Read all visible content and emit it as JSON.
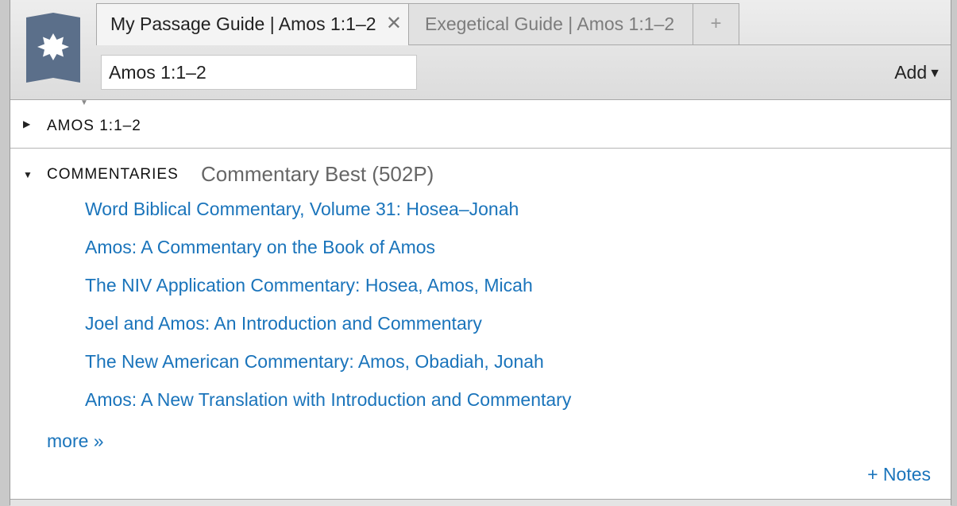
{
  "tabs": [
    {
      "label": "My Passage Guide | Amos 1:1–2",
      "active": true
    },
    {
      "label": "Exegetical Guide | Amos 1:1–2",
      "active": false
    }
  ],
  "tab_add_label": "+",
  "tab_close_label": "✕",
  "reference_input": {
    "value": "Amos 1:1–2"
  },
  "add_button": {
    "label": "Add",
    "arrow": "▼"
  },
  "sections": {
    "passage": {
      "title": "AMOS 1:1–2",
      "expanded": false,
      "toggle": "▶"
    },
    "commentaries": {
      "title": "COMMENTARIES",
      "subtitle": "Commentary Best (502P)",
      "expanded": true,
      "toggle": "▼",
      "links": [
        "Word Biblical Commentary, Volume 31: Hosea–Jonah",
        "Amos: A Commentary on the Book of Amos",
        "The NIV Application Commentary: Hosea, Amos, Micah",
        "Joel and Amos: An Introduction and Commentary",
        "The New American Commentary: Amos, Obadiah, Jonah",
        "Amos: A New Translation with Introduction and Commentary"
      ],
      "more_label": "more »"
    }
  },
  "notes_label": "+ Notes",
  "colors": {
    "link": "#1a74bb",
    "logo": "#5b6f8a"
  },
  "icons": {
    "logo": "guide-badge-icon",
    "close": "close-icon",
    "disclosure": "disclosure-triangle-icon"
  }
}
